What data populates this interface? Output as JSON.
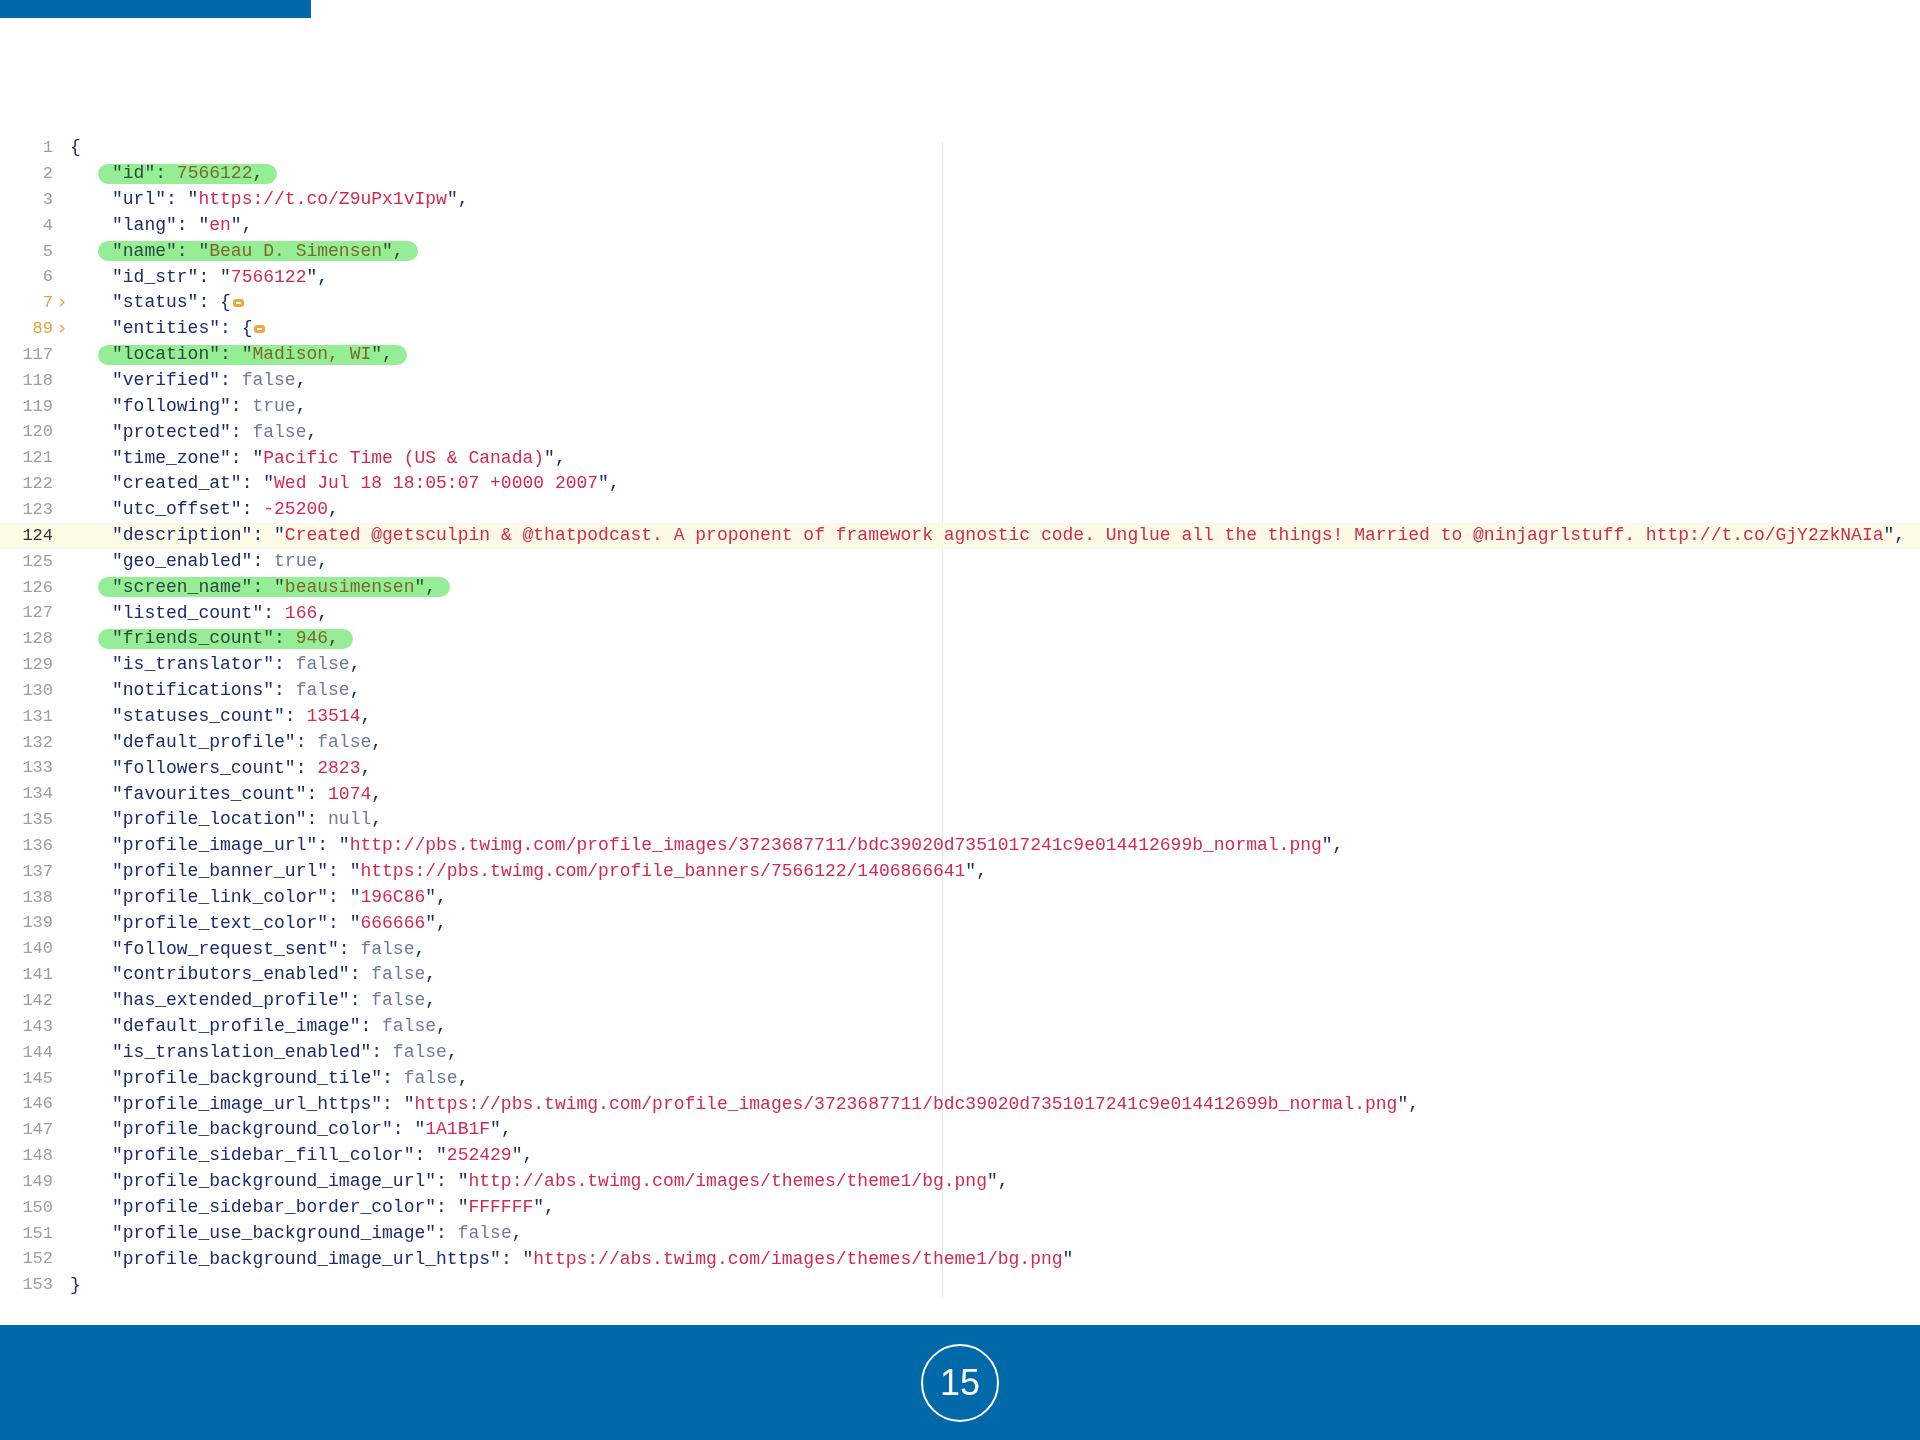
{
  "editor": {
    "lines": [
      {
        "number": "1",
        "folded": false,
        "highlighted": false,
        "current": false,
        "tokens": [
          {
            "kind": "punct",
            "text": "{"
          }
        ],
        "children": [
          {
            "number": "2",
            "folded": false,
            "highlighted": true,
            "current": false,
            "tokens": [
              {
                "kind": "key",
                "text": "\"id\""
              },
              {
                "kind": "punct",
                "text": ": "
              },
              {
                "kind": "number",
                "text": "7566122"
              },
              {
                "kind": "punct",
                "text": ","
              }
            ]
          },
          {
            "number": "3",
            "folded": false,
            "highlighted": false,
            "current": false,
            "tokens": [
              {
                "kind": "key",
                "text": "\"url\""
              },
              {
                "kind": "punct",
                "text": ": \""
              },
              {
                "kind": "string",
                "text": "https://t.co/Z9uPx1vIpw"
              },
              {
                "kind": "punct",
                "text": "\","
              }
            ]
          },
          {
            "number": "4",
            "folded": false,
            "highlighted": false,
            "current": false,
            "tokens": [
              {
                "kind": "key",
                "text": "\"lang\""
              },
              {
                "kind": "punct",
                "text": ": \""
              },
              {
                "kind": "string",
                "text": "en"
              },
              {
                "kind": "punct",
                "text": "\","
              }
            ]
          },
          {
            "number": "5",
            "folded": false,
            "highlighted": true,
            "current": false,
            "tokens": [
              {
                "kind": "key",
                "text": "\"name\""
              },
              {
                "kind": "punct",
                "text": ": \""
              },
              {
                "kind": "string",
                "text": "Beau D. Simensen"
              },
              {
                "kind": "punct",
                "text": "\","
              }
            ]
          },
          {
            "number": "6",
            "folded": false,
            "highlighted": false,
            "current": false,
            "tokens": [
              {
                "kind": "key",
                "text": "\"id_str\""
              },
              {
                "kind": "punct",
                "text": ": \""
              },
              {
                "kind": "string",
                "text": "7566122"
              },
              {
                "kind": "punct",
                "text": "\","
              }
            ]
          },
          {
            "number": "7",
            "folded": true,
            "highlighted": false,
            "current": false,
            "tokens": [
              {
                "kind": "key",
                "text": "\"status\""
              },
              {
                "kind": "punct",
                "text": ": {"
              }
            ]
          },
          {
            "number": "89",
            "folded": true,
            "highlighted": false,
            "current": false,
            "tokens": [
              {
                "kind": "key",
                "text": "\"entities\""
              },
              {
                "kind": "punct",
                "text": ": {"
              }
            ]
          },
          {
            "number": "117",
            "folded": false,
            "highlighted": true,
            "current": false,
            "tokens": [
              {
                "kind": "key",
                "text": "\"location\""
              },
              {
                "kind": "punct",
                "text": ": \""
              },
              {
                "kind": "string",
                "text": "Madison, WI"
              },
              {
                "kind": "punct",
                "text": "\","
              }
            ]
          },
          {
            "number": "118",
            "folded": false,
            "highlighted": false,
            "current": false,
            "tokens": [
              {
                "kind": "key",
                "text": "\"verified\""
              },
              {
                "kind": "punct",
                "text": ": "
              },
              {
                "kind": "literal",
                "text": "false"
              },
              {
                "kind": "punct",
                "text": ","
              }
            ]
          },
          {
            "number": "119",
            "folded": false,
            "highlighted": false,
            "current": false,
            "tokens": [
              {
                "kind": "key",
                "text": "\"following\""
              },
              {
                "kind": "punct",
                "text": ": "
              },
              {
                "kind": "literal",
                "text": "true"
              },
              {
                "kind": "punct",
                "text": ","
              }
            ]
          },
          {
            "number": "120",
            "folded": false,
            "highlighted": false,
            "current": false,
            "tokens": [
              {
                "kind": "key",
                "text": "\"protected\""
              },
              {
                "kind": "punct",
                "text": ": "
              },
              {
                "kind": "literal",
                "text": "false"
              },
              {
                "kind": "punct",
                "text": ","
              }
            ]
          },
          {
            "number": "121",
            "folded": false,
            "highlighted": false,
            "current": false,
            "tokens": [
              {
                "kind": "key",
                "text": "\"time_zone\""
              },
              {
                "kind": "punct",
                "text": ": \""
              },
              {
                "kind": "string",
                "text": "Pacific Time (US & Canada)"
              },
              {
                "kind": "punct",
                "text": "\","
              }
            ]
          },
          {
            "number": "122",
            "folded": false,
            "highlighted": false,
            "current": false,
            "tokens": [
              {
                "kind": "key",
                "text": "\"created_at\""
              },
              {
                "kind": "punct",
                "text": ": \""
              },
              {
                "kind": "string",
                "text": "Wed Jul 18 18:05:07 +0000 2007"
              },
              {
                "kind": "punct",
                "text": "\","
              }
            ]
          },
          {
            "number": "123",
            "folded": false,
            "highlighted": false,
            "current": false,
            "tokens": [
              {
                "kind": "key",
                "text": "\"utc_offset\""
              },
              {
                "kind": "punct",
                "text": ": "
              },
              {
                "kind": "number",
                "text": "-25200"
              },
              {
                "kind": "punct",
                "text": ","
              }
            ]
          },
          {
            "number": "124",
            "folded": false,
            "highlighted": false,
            "current": true,
            "tokens": [
              {
                "kind": "key",
                "text": "\"description\""
              },
              {
                "kind": "punct",
                "text": ": \""
              },
              {
                "kind": "string",
                "text": "Created @getsculpin & @thatpodcast. A proponent of framework agnostic code. Unglue all the things! Married to @ninjagrlstuff. http://t.co/GjY2zkNAIa"
              },
              {
                "kind": "punct",
                "text": "\","
              }
            ]
          },
          {
            "number": "125",
            "folded": false,
            "highlighted": false,
            "current": false,
            "tokens": [
              {
                "kind": "key",
                "text": "\"geo_enabled\""
              },
              {
                "kind": "punct",
                "text": ": "
              },
              {
                "kind": "literal",
                "text": "true"
              },
              {
                "kind": "punct",
                "text": ","
              }
            ]
          },
          {
            "number": "126",
            "folded": false,
            "highlighted": true,
            "current": false,
            "tokens": [
              {
                "kind": "key",
                "text": "\"screen_name\""
              },
              {
                "kind": "punct",
                "text": ": \""
              },
              {
                "kind": "string",
                "text": "beausimensen"
              },
              {
                "kind": "punct",
                "text": "\","
              }
            ]
          },
          {
            "number": "127",
            "folded": false,
            "highlighted": false,
            "current": false,
            "tokens": [
              {
                "kind": "key",
                "text": "\"listed_count\""
              },
              {
                "kind": "punct",
                "text": ": "
              },
              {
                "kind": "number",
                "text": "166"
              },
              {
                "kind": "punct",
                "text": ","
              }
            ]
          },
          {
            "number": "128",
            "folded": false,
            "highlighted": true,
            "current": false,
            "tokens": [
              {
                "kind": "key",
                "text": "\"friends_count\""
              },
              {
                "kind": "punct",
                "text": ": "
              },
              {
                "kind": "number",
                "text": "946"
              },
              {
                "kind": "punct",
                "text": ","
              }
            ]
          },
          {
            "number": "129",
            "folded": false,
            "highlighted": false,
            "current": false,
            "tokens": [
              {
                "kind": "key",
                "text": "\"is_translator\""
              },
              {
                "kind": "punct",
                "text": ": "
              },
              {
                "kind": "literal",
                "text": "false"
              },
              {
                "kind": "punct",
                "text": ","
              }
            ]
          },
          {
            "number": "130",
            "folded": false,
            "highlighted": false,
            "current": false,
            "tokens": [
              {
                "kind": "key",
                "text": "\"notifications\""
              },
              {
                "kind": "punct",
                "text": ": "
              },
              {
                "kind": "literal",
                "text": "false"
              },
              {
                "kind": "punct",
                "text": ","
              }
            ]
          },
          {
            "number": "131",
            "folded": false,
            "highlighted": false,
            "current": false,
            "tokens": [
              {
                "kind": "key",
                "text": "\"statuses_count\""
              },
              {
                "kind": "punct",
                "text": ": "
              },
              {
                "kind": "number",
                "text": "13514"
              },
              {
                "kind": "punct",
                "text": ","
              }
            ]
          },
          {
            "number": "132",
            "folded": false,
            "highlighted": false,
            "current": false,
            "tokens": [
              {
                "kind": "key",
                "text": "\"default_profile\""
              },
              {
                "kind": "punct",
                "text": ": "
              },
              {
                "kind": "literal",
                "text": "false"
              },
              {
                "kind": "punct",
                "text": ","
              }
            ]
          },
          {
            "number": "133",
            "folded": false,
            "highlighted": false,
            "current": false,
            "tokens": [
              {
                "kind": "key",
                "text": "\"followers_count\""
              },
              {
                "kind": "punct",
                "text": ": "
              },
              {
                "kind": "number",
                "text": "2823"
              },
              {
                "kind": "punct",
                "text": ","
              }
            ]
          },
          {
            "number": "134",
            "folded": false,
            "highlighted": false,
            "current": false,
            "tokens": [
              {
                "kind": "key",
                "text": "\"favourites_count\""
              },
              {
                "kind": "punct",
                "text": ": "
              },
              {
                "kind": "number",
                "text": "1074"
              },
              {
                "kind": "punct",
                "text": ","
              }
            ]
          },
          {
            "number": "135",
            "folded": false,
            "highlighted": false,
            "current": false,
            "tokens": [
              {
                "kind": "key",
                "text": "\"profile_location\""
              },
              {
                "kind": "punct",
                "text": ": "
              },
              {
                "kind": "literal",
                "text": "null"
              },
              {
                "kind": "punct",
                "text": ","
              }
            ]
          },
          {
            "number": "136",
            "folded": false,
            "highlighted": false,
            "current": false,
            "tokens": [
              {
                "kind": "key",
                "text": "\"profile_image_url\""
              },
              {
                "kind": "punct",
                "text": ": \""
              },
              {
                "kind": "string",
                "text": "http://pbs.twimg.com/profile_images/3723687711/bdc39020d7351017241c9e014412699b_normal.png"
              },
              {
                "kind": "punct",
                "text": "\","
              }
            ]
          },
          {
            "number": "137",
            "folded": false,
            "highlighted": false,
            "current": false,
            "tokens": [
              {
                "kind": "key",
                "text": "\"profile_banner_url\""
              },
              {
                "kind": "punct",
                "text": ": \""
              },
              {
                "kind": "string",
                "text": "https://pbs.twimg.com/profile_banners/7566122/1406866641"
              },
              {
                "kind": "punct",
                "text": "\","
              }
            ]
          },
          {
            "number": "138",
            "folded": false,
            "highlighted": false,
            "current": false,
            "tokens": [
              {
                "kind": "key",
                "text": "\"profile_link_color\""
              },
              {
                "kind": "punct",
                "text": ": \""
              },
              {
                "kind": "string",
                "text": "196C86"
              },
              {
                "kind": "punct",
                "text": "\","
              }
            ]
          },
          {
            "number": "139",
            "folded": false,
            "highlighted": false,
            "current": false,
            "tokens": [
              {
                "kind": "key",
                "text": "\"profile_text_color\""
              },
              {
                "kind": "punct",
                "text": ": \""
              },
              {
                "kind": "string",
                "text": "666666"
              },
              {
                "kind": "punct",
                "text": "\","
              }
            ]
          },
          {
            "number": "140",
            "folded": false,
            "highlighted": false,
            "current": false,
            "tokens": [
              {
                "kind": "key",
                "text": "\"follow_request_sent\""
              },
              {
                "kind": "punct",
                "text": ": "
              },
              {
                "kind": "literal",
                "text": "false"
              },
              {
                "kind": "punct",
                "text": ","
              }
            ]
          },
          {
            "number": "141",
            "folded": false,
            "highlighted": false,
            "current": false,
            "tokens": [
              {
                "kind": "key",
                "text": "\"contributors_enabled\""
              },
              {
                "kind": "punct",
                "text": ": "
              },
              {
                "kind": "literal",
                "text": "false"
              },
              {
                "kind": "punct",
                "text": ","
              }
            ]
          },
          {
            "number": "142",
            "folded": false,
            "highlighted": false,
            "current": false,
            "tokens": [
              {
                "kind": "key",
                "text": "\"has_extended_profile\""
              },
              {
                "kind": "punct",
                "text": ": "
              },
              {
                "kind": "literal",
                "text": "false"
              },
              {
                "kind": "punct",
                "text": ","
              }
            ]
          },
          {
            "number": "143",
            "folded": false,
            "highlighted": false,
            "current": false,
            "tokens": [
              {
                "kind": "key",
                "text": "\"default_profile_image\""
              },
              {
                "kind": "punct",
                "text": ": "
              },
              {
                "kind": "literal",
                "text": "false"
              },
              {
                "kind": "punct",
                "text": ","
              }
            ]
          },
          {
            "number": "144",
            "folded": false,
            "highlighted": false,
            "current": false,
            "tokens": [
              {
                "kind": "key",
                "text": "\"is_translation_enabled\""
              },
              {
                "kind": "punct",
                "text": ": "
              },
              {
                "kind": "literal",
                "text": "false"
              },
              {
                "kind": "punct",
                "text": ","
              }
            ]
          },
          {
            "number": "145",
            "folded": false,
            "highlighted": false,
            "current": false,
            "tokens": [
              {
                "kind": "key",
                "text": "\"profile_background_tile\""
              },
              {
                "kind": "punct",
                "text": ": "
              },
              {
                "kind": "literal",
                "text": "false"
              },
              {
                "kind": "punct",
                "text": ","
              }
            ]
          },
          {
            "number": "146",
            "folded": false,
            "highlighted": false,
            "current": false,
            "tokens": [
              {
                "kind": "key",
                "text": "\"profile_image_url_https\""
              },
              {
                "kind": "punct",
                "text": ": \""
              },
              {
                "kind": "string",
                "text": "https://pbs.twimg.com/profile_images/3723687711/bdc39020d7351017241c9e014412699b_normal.png"
              },
              {
                "kind": "punct",
                "text": "\","
              }
            ]
          },
          {
            "number": "147",
            "folded": false,
            "highlighted": false,
            "current": false,
            "tokens": [
              {
                "kind": "key",
                "text": "\"profile_background_color\""
              },
              {
                "kind": "punct",
                "text": ": \""
              },
              {
                "kind": "string",
                "text": "1A1B1F"
              },
              {
                "kind": "punct",
                "text": "\","
              }
            ]
          },
          {
            "number": "148",
            "folded": false,
            "highlighted": false,
            "current": false,
            "tokens": [
              {
                "kind": "key",
                "text": "\"profile_sidebar_fill_color\""
              },
              {
                "kind": "punct",
                "text": ": \""
              },
              {
                "kind": "string",
                "text": "252429"
              },
              {
                "kind": "punct",
                "text": "\","
              }
            ]
          },
          {
            "number": "149",
            "folded": false,
            "highlighted": false,
            "current": false,
            "tokens": [
              {
                "kind": "key",
                "text": "\"profile_background_image_url\""
              },
              {
                "kind": "punct",
                "text": ": \""
              },
              {
                "kind": "string",
                "text": "http://abs.twimg.com/images/themes/theme1/bg.png"
              },
              {
                "kind": "punct",
                "text": "\","
              }
            ]
          },
          {
            "number": "150",
            "folded": false,
            "highlighted": false,
            "current": false,
            "tokens": [
              {
                "kind": "key",
                "text": "\"profile_sidebar_border_color\""
              },
              {
                "kind": "punct",
                "text": ": \""
              },
              {
                "kind": "string",
                "text": "FFFFFF"
              },
              {
                "kind": "punct",
                "text": "\","
              }
            ]
          },
          {
            "number": "151",
            "folded": false,
            "highlighted": false,
            "current": false,
            "tokens": [
              {
                "kind": "key",
                "text": "\"profile_use_background_image\""
              },
              {
                "kind": "punct",
                "text": ": "
              },
              {
                "kind": "literal",
                "text": "false"
              },
              {
                "kind": "punct",
                "text": ","
              }
            ]
          },
          {
            "number": "152",
            "folded": false,
            "highlighted": false,
            "current": false,
            "tokens": [
              {
                "kind": "key",
                "text": "\"profile_background_image_url_https\""
              },
              {
                "kind": "punct",
                "text": ": \""
              },
              {
                "kind": "string",
                "text": "https://abs.twimg.com/images/themes/theme1/bg.png"
              },
              {
                "kind": "punct",
                "text": "\""
              }
            ]
          }
        ]
      },
      {
        "number": "153",
        "folded": false,
        "highlighted": false,
        "current": false,
        "tokens": [
          {
            "kind": "punct",
            "text": "}"
          }
        ]
      }
    ]
  },
  "footer": {
    "page_number": "15"
  }
}
